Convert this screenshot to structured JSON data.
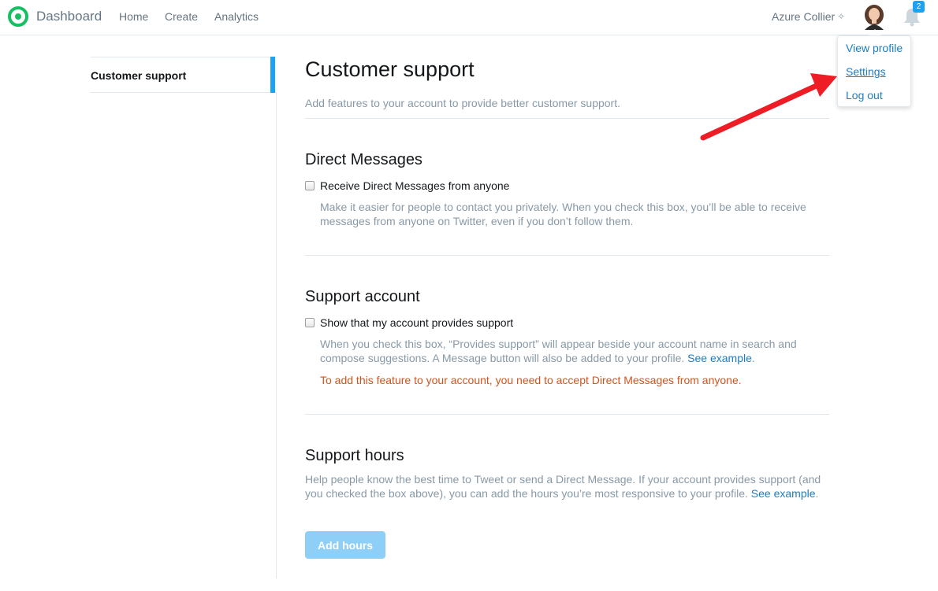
{
  "header": {
    "brand": "Dashboard",
    "nav": [
      "Home",
      "Create",
      "Analytics"
    ],
    "username": "Azure Collier",
    "notification_count": "2",
    "brand_color": "#17bf63"
  },
  "dropdown": {
    "items": [
      "View profile",
      "Settings",
      "Log out"
    ]
  },
  "sidebar": {
    "items": [
      {
        "label": "Customer support",
        "active": true
      }
    ]
  },
  "main": {
    "title": "Customer support",
    "subtitle": "Add features to your account to provide better customer support.",
    "direct_messages": {
      "heading": "Direct Messages",
      "checkbox_label": "Receive Direct Messages from anyone",
      "checked": false,
      "help": "Make it easier for people to contact you privately. When you check this box, you’ll be able to receive messages from anyone on Twitter, even if you don’t follow them."
    },
    "support_account": {
      "heading": "Support account",
      "checkbox_label": "Show that my account provides support",
      "checked": false,
      "help": "When you check this box, “Provides support” will appear beside your account name in search and compose suggestions. A Message button will also be added to your profile.",
      "help_link": "See example",
      "help_end": ".",
      "warning": "To add this feature to your account, you need to accept Direct Messages from anyone."
    },
    "support_hours": {
      "heading": "Support hours",
      "help": "Help people know the best time to Tweet or send a Direct Message. If your account provides support (and you checked the box above), you can add the hours you’re most responsive to your profile.",
      "help_link": "See example",
      "help_end": ".",
      "button": "Add hours"
    }
  },
  "colors": {
    "accent": "#1da1f2",
    "link": "#1d7cc4",
    "warning": "#d0541e",
    "annotation_arrow": "#ee1c24"
  }
}
